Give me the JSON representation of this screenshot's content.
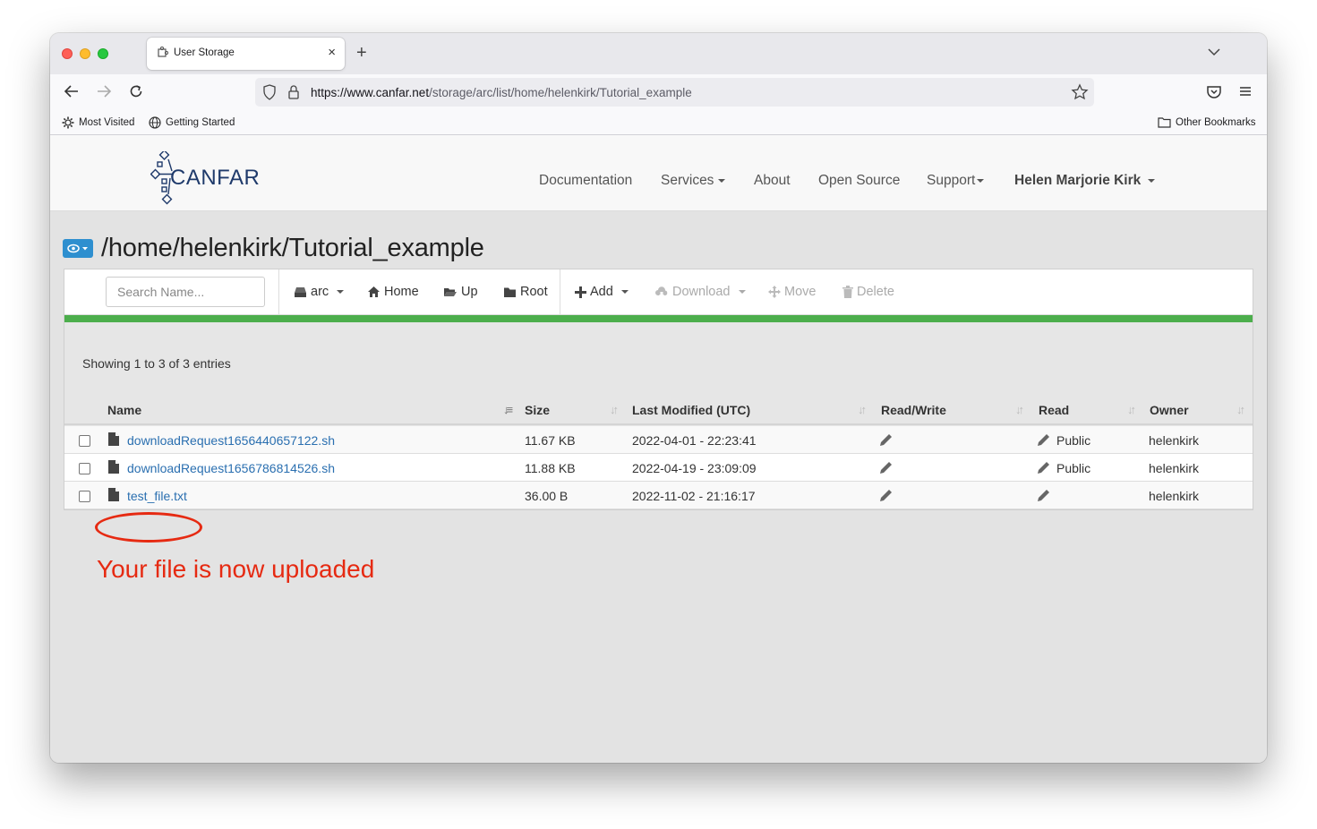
{
  "browser": {
    "tab_title": "User Storage",
    "new_tab": "+",
    "url_host": "https://www.canfar.net",
    "url_path": "/storage/arc/list/home/helenkirk/Tutorial_example",
    "bookmarks": [
      "Most Visited",
      "Getting Started"
    ],
    "other_bookmarks": "Other Bookmarks"
  },
  "site": {
    "logo_text": "CANFAR",
    "nav": {
      "documentation": "Documentation",
      "services": "Services",
      "about": "About",
      "open_source": "Open Source",
      "support": "Support",
      "user": "Helen Marjorie Kirk"
    }
  },
  "storage": {
    "path": "/home/helenkirk/Tutorial_example",
    "search_placeholder": "Search Name...",
    "toolbar": {
      "arc": "arc",
      "home": "Home",
      "up": "Up",
      "root": "Root",
      "add": "Add",
      "download": "Download",
      "move": "Move",
      "delete": "Delete"
    },
    "showing": "Showing 1 to 3 of 3 entries",
    "columns": {
      "name": "Name",
      "size": "Size",
      "modified": "Last Modified (UTC)",
      "read_write": "Read/Write",
      "read": "Read",
      "owner": "Owner"
    },
    "rows": [
      {
        "name": "downloadRequest1656440657122.sh",
        "size": "11.67 KB",
        "modified": "2022-04-01 - 22:23:41",
        "read": "Public",
        "owner": "helenkirk"
      },
      {
        "name": "downloadRequest1656786814526.sh",
        "size": "11.88 KB",
        "modified": "2022-04-19 - 23:09:09",
        "read": "Public",
        "owner": "helenkirk"
      },
      {
        "name": "test_file.txt",
        "size": "36.00 B",
        "modified": "2022-11-02 - 21:16:17",
        "read": "",
        "owner": "helenkirk"
      }
    ]
  },
  "annotation": {
    "text": "Your file is now uploaded",
    "color": "#e62a12"
  },
  "colors": {
    "link": "#2a6fb0",
    "progress": "#4cae4c",
    "view_button": "#2e8fcf"
  }
}
